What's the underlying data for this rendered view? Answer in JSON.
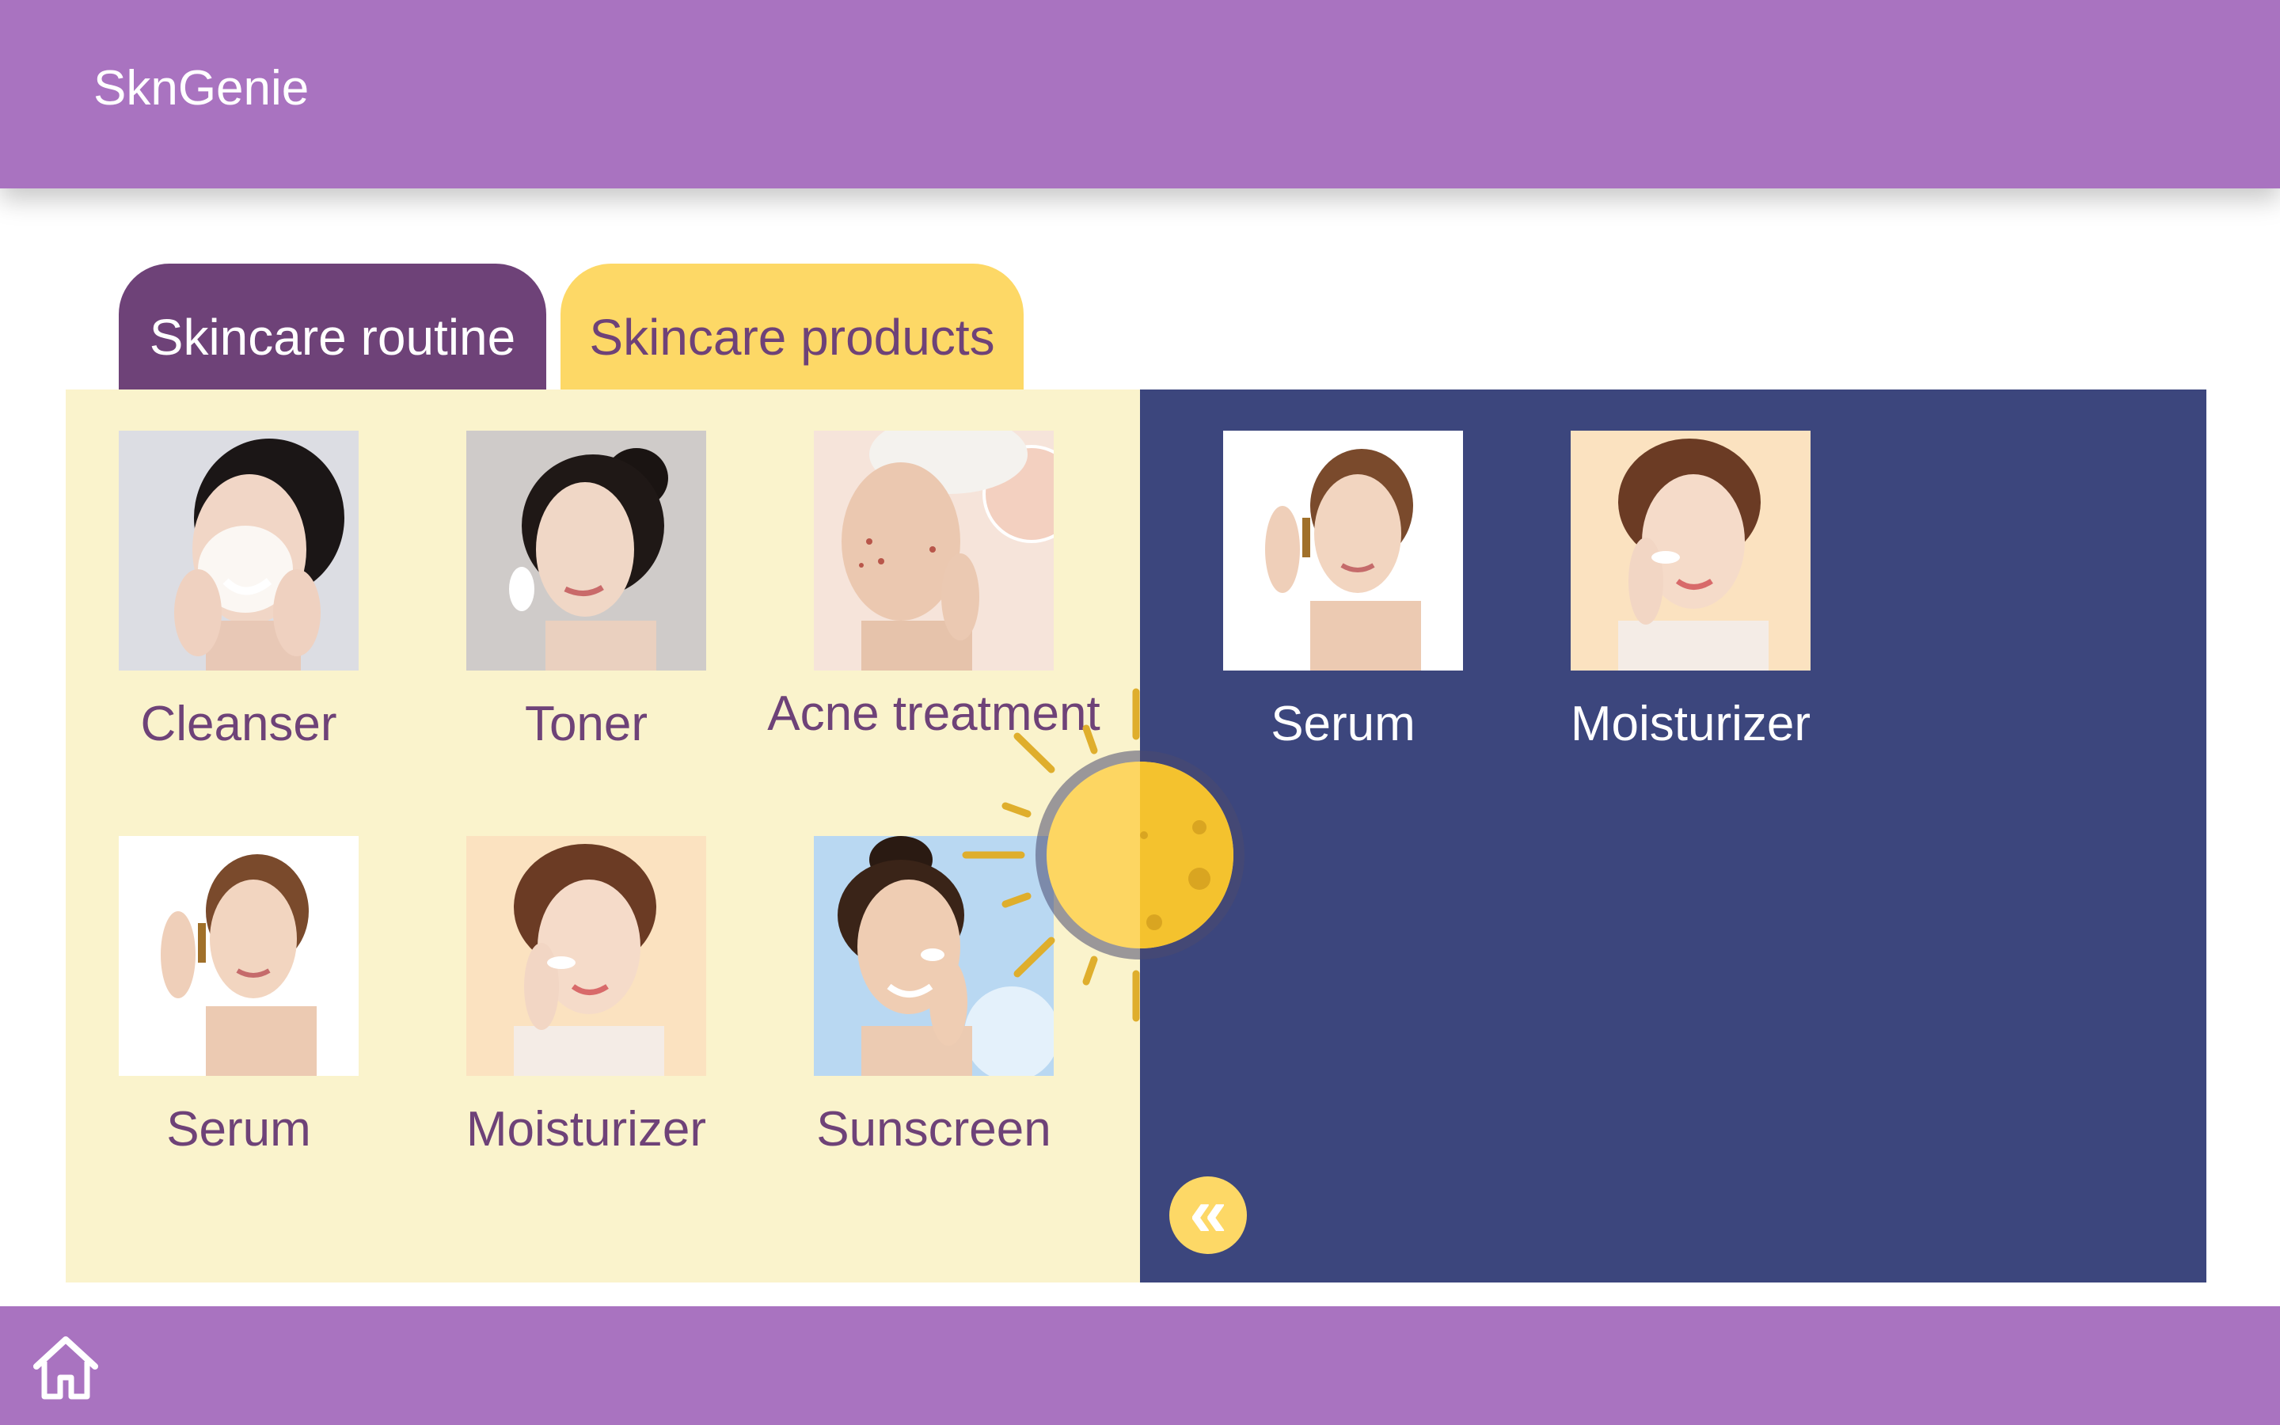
{
  "header": {
    "app_title": "SknGenie"
  },
  "tabs": [
    {
      "label": "Skincare routine",
      "active": true
    },
    {
      "label": "Skincare products",
      "active": false
    }
  ],
  "routine_items": [
    {
      "label": "Cleanser",
      "icon": "cleanser-photo"
    },
    {
      "label": "Toner",
      "icon": "toner-photo"
    },
    {
      "label": "Acne treatment",
      "icon": "acne-photo"
    },
    {
      "label": "Serum",
      "icon": "serum-photo"
    },
    {
      "label": "Moisturizer",
      "icon": "moisturizer-photo"
    },
    {
      "label": "Sunscreen",
      "icon": "sunscreen-photo"
    }
  ],
  "selected_items": [
    {
      "label": "Serum",
      "icon": "serum-photo"
    },
    {
      "label": "Moisturizer",
      "icon": "moisturizer-photo"
    }
  ],
  "controls": {
    "collapse_glyph": "«",
    "home_icon": "home-icon"
  },
  "colors": {
    "header": "#a973c0",
    "tab_active": "#6e4278",
    "tab_inactive": "#fdd866",
    "panel_left": "#faf3cc",
    "panel_right": "#3c467d",
    "sun": "#f6c431"
  }
}
